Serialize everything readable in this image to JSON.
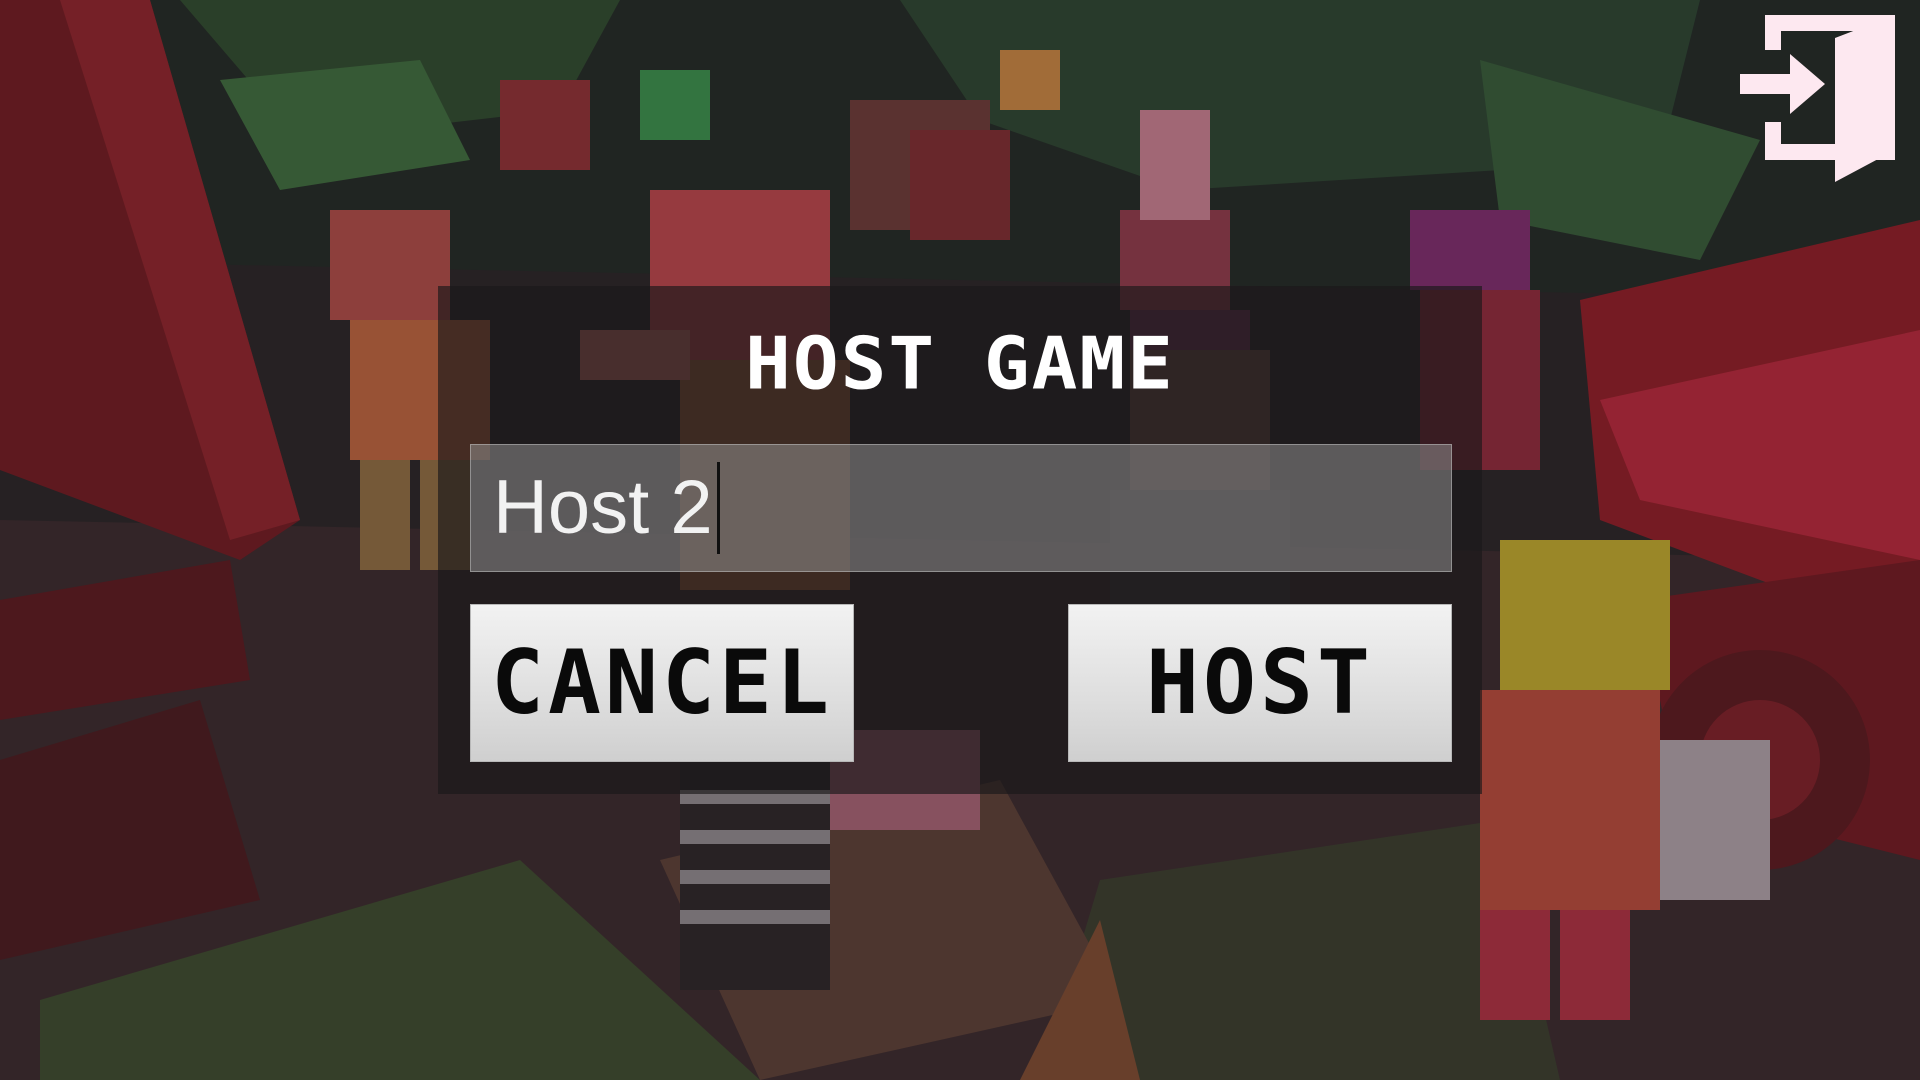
{
  "dialog": {
    "title": "HOST GAME",
    "host_name_value": "Host 2",
    "cancel_label": "CANCEL",
    "host_label": "HOST"
  },
  "icons": {
    "exit": "exit-door-icon"
  },
  "colors": {
    "dialog_background": "#1a181a",
    "button_face": "#e2e2e2",
    "button_text": "#0a0a0a",
    "title_text": "#ffffff",
    "exit_icon": "#fde8f0"
  }
}
